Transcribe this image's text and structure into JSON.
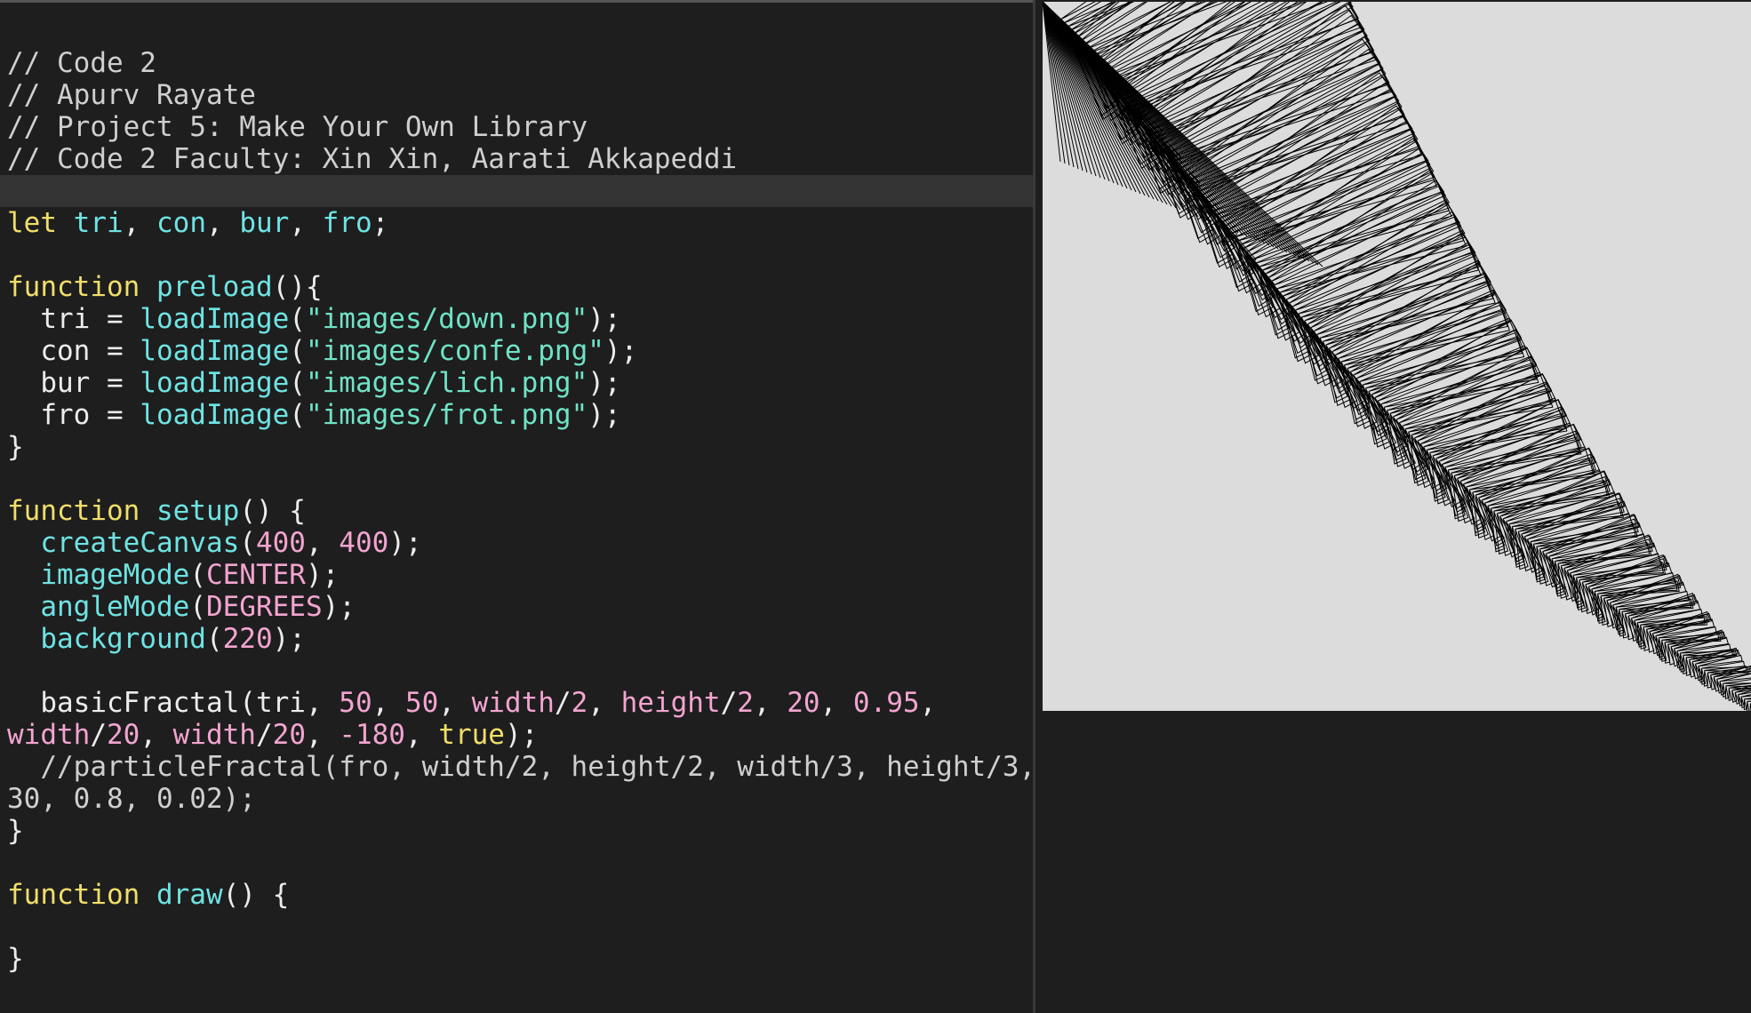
{
  "editor": {
    "lines": [
      [
        {
          "t": "// Code 2",
          "c": "comment"
        }
      ],
      [
        {
          "t": "// Apurv Rayate",
          "c": "comment"
        }
      ],
      [
        {
          "t": "// Project 5: Make Your Own Library",
          "c": "comment"
        }
      ],
      [
        {
          "t": "// Code 2 Faculty: Xin Xin, Aarati Akkapeddi",
          "c": "comment"
        }
      ],
      [],
      [
        {
          "t": "let",
          "c": "kw"
        },
        {
          "t": " ",
          "c": "plain"
        },
        {
          "t": "tri",
          "c": "fn"
        },
        {
          "t": ", ",
          "c": "plain"
        },
        {
          "t": "con",
          "c": "fn"
        },
        {
          "t": ", ",
          "c": "plain"
        },
        {
          "t": "bur",
          "c": "fn"
        },
        {
          "t": ", ",
          "c": "plain"
        },
        {
          "t": "fro",
          "c": "fn"
        },
        {
          "t": ";",
          "c": "plain"
        }
      ],
      [],
      [
        {
          "t": "function",
          "c": "kw"
        },
        {
          "t": " ",
          "c": "plain"
        },
        {
          "t": "preload",
          "c": "fn"
        },
        {
          "t": "(){",
          "c": "plain"
        }
      ],
      [
        {
          "t": "  tri = ",
          "c": "plain"
        },
        {
          "t": "loadImage",
          "c": "fn"
        },
        {
          "t": "(",
          "c": "plain"
        },
        {
          "t": "\"images/down.png\"",
          "c": "str"
        },
        {
          "t": ");",
          "c": "plain"
        }
      ],
      [
        {
          "t": "  con = ",
          "c": "plain"
        },
        {
          "t": "loadImage",
          "c": "fn"
        },
        {
          "t": "(",
          "c": "plain"
        },
        {
          "t": "\"images/confe.png\"",
          "c": "str"
        },
        {
          "t": ");",
          "c": "plain"
        }
      ],
      [
        {
          "t": "  bur = ",
          "c": "plain"
        },
        {
          "t": "loadImage",
          "c": "fn"
        },
        {
          "t": "(",
          "c": "plain"
        },
        {
          "t": "\"images/lich.png\"",
          "c": "str"
        },
        {
          "t": ");",
          "c": "plain"
        }
      ],
      [
        {
          "t": "  fro = ",
          "c": "plain"
        },
        {
          "t": "loadImage",
          "c": "fn"
        },
        {
          "t": "(",
          "c": "plain"
        },
        {
          "t": "\"images/frot.png\"",
          "c": "str"
        },
        {
          "t": ");",
          "c": "plain"
        }
      ],
      [
        {
          "t": "}",
          "c": "plain"
        }
      ],
      [],
      [
        {
          "t": "function",
          "c": "kw"
        },
        {
          "t": " ",
          "c": "plain"
        },
        {
          "t": "setup",
          "c": "fn"
        },
        {
          "t": "() {",
          "c": "plain"
        }
      ],
      [
        {
          "t": "  ",
          "c": "plain"
        },
        {
          "t": "createCanvas",
          "c": "fn"
        },
        {
          "t": "(",
          "c": "plain"
        },
        {
          "t": "400",
          "c": "num"
        },
        {
          "t": ", ",
          "c": "plain"
        },
        {
          "t": "400",
          "c": "num"
        },
        {
          "t": ");",
          "c": "plain"
        }
      ],
      [
        {
          "t": "  ",
          "c": "plain"
        },
        {
          "t": "imageMode",
          "c": "fn"
        },
        {
          "t": "(",
          "c": "plain"
        },
        {
          "t": "CENTER",
          "c": "const"
        },
        {
          "t": ");",
          "c": "plain"
        }
      ],
      [
        {
          "t": "  ",
          "c": "plain"
        },
        {
          "t": "angleMode",
          "c": "fn"
        },
        {
          "t": "(",
          "c": "plain"
        },
        {
          "t": "DEGREES",
          "c": "const"
        },
        {
          "t": ");",
          "c": "plain"
        }
      ],
      [
        {
          "t": "  ",
          "c": "plain"
        },
        {
          "t": "background",
          "c": "fn"
        },
        {
          "t": "(",
          "c": "plain"
        },
        {
          "t": "220",
          "c": "num"
        },
        {
          "t": ");",
          "c": "plain"
        }
      ],
      [],
      [
        {
          "t": "  basicFractal(tri, ",
          "c": "plain"
        },
        {
          "t": "50",
          "c": "num"
        },
        {
          "t": ", ",
          "c": "plain"
        },
        {
          "t": "50",
          "c": "num"
        },
        {
          "t": ", ",
          "c": "plain"
        },
        {
          "t": "width",
          "c": "const"
        },
        {
          "t": "/",
          "c": "plain"
        },
        {
          "t": "2",
          "c": "num"
        },
        {
          "t": ", ",
          "c": "plain"
        },
        {
          "t": "height",
          "c": "const"
        },
        {
          "t": "/",
          "c": "plain"
        },
        {
          "t": "2",
          "c": "num"
        },
        {
          "t": ", ",
          "c": "plain"
        },
        {
          "t": "20",
          "c": "num"
        },
        {
          "t": ", ",
          "c": "plain"
        },
        {
          "t": "0.95",
          "c": "num"
        },
        {
          "t": ",",
          "c": "plain"
        }
      ],
      [
        {
          "t": "width",
          "c": "const"
        },
        {
          "t": "/",
          "c": "plain"
        },
        {
          "t": "20",
          "c": "num"
        },
        {
          "t": ", ",
          "c": "plain"
        },
        {
          "t": "width",
          "c": "const"
        },
        {
          "t": "/",
          "c": "plain"
        },
        {
          "t": "20",
          "c": "num"
        },
        {
          "t": ", ",
          "c": "plain"
        },
        {
          "t": "-180",
          "c": "num"
        },
        {
          "t": ", ",
          "c": "plain"
        },
        {
          "t": "true",
          "c": "kw"
        },
        {
          "t": ");",
          "c": "plain"
        }
      ],
      [
        {
          "t": "  //particleFractal(fro, width/2, height/2, width/3, height/3,",
          "c": "comment"
        }
      ],
      [
        {
          "t": "30, 0.8, 0.02);",
          "c": "comment"
        }
      ],
      [
        {
          "t": "}",
          "c": "plain"
        }
      ],
      [],
      [
        {
          "t": "function",
          "c": "kw"
        },
        {
          "t": " ",
          "c": "plain"
        },
        {
          "t": "draw",
          "c": "fn"
        },
        {
          "t": "() {",
          "c": "plain"
        }
      ],
      [],
      [
        {
          "t": "}",
          "c": "plain"
        }
      ]
    ],
    "active_line": 4
  },
  "preview": {
    "background": "#dcdcdc",
    "stroke": "#000000",
    "content": "fractal-triangle-render"
  },
  "colors": {
    "editor_bg": "#1e1e1e",
    "comment": "#cfcfcf",
    "keyword": "#f0de6a",
    "function": "#6fe3e3",
    "string": "#6fe3c6",
    "number": "#f3a4d0"
  }
}
